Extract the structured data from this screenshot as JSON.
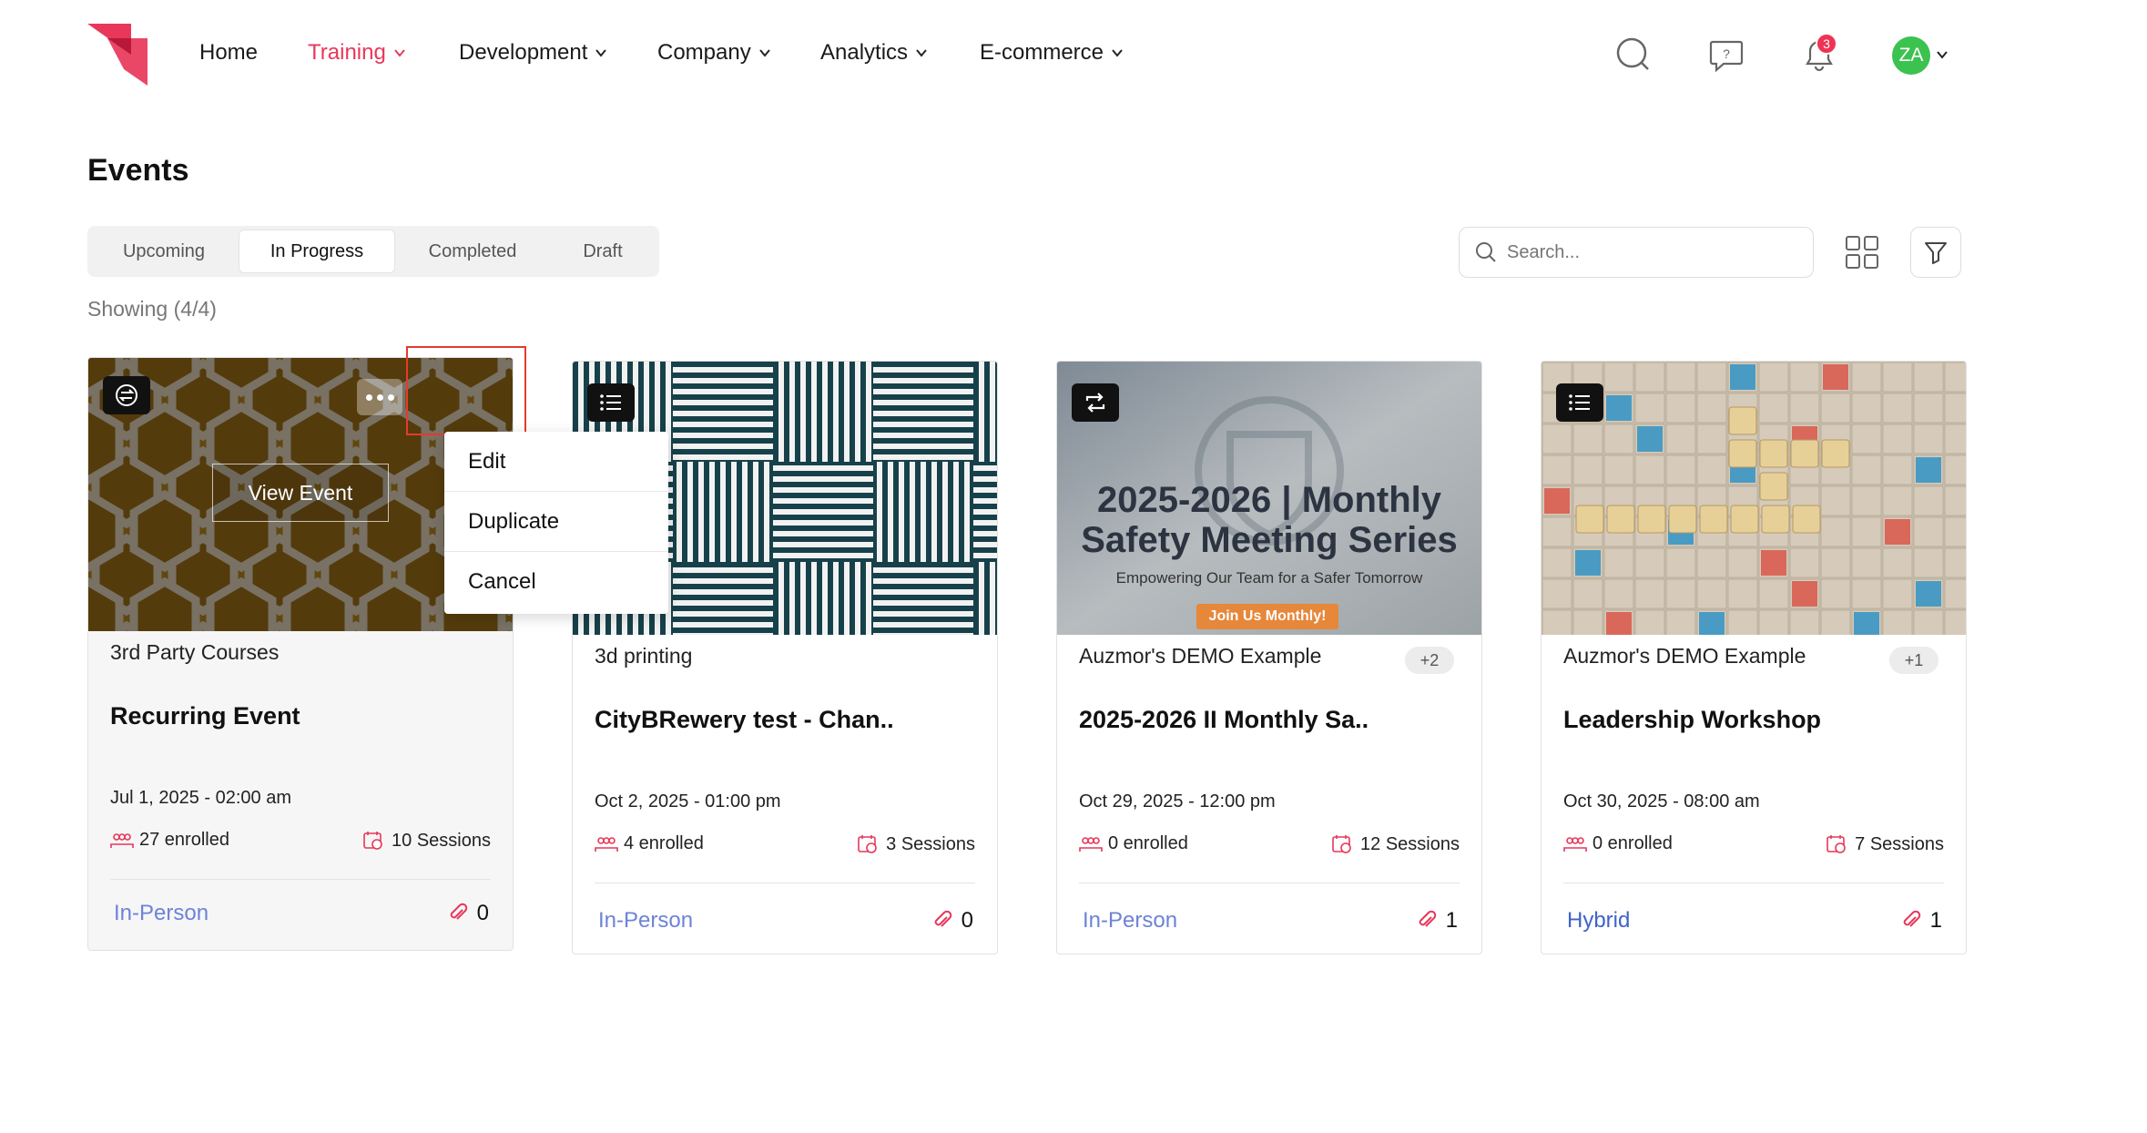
{
  "nav": {
    "items": [
      {
        "label": "Home",
        "has_dropdown": false,
        "active": false
      },
      {
        "label": "Training",
        "has_dropdown": true,
        "active": true
      },
      {
        "label": "Development",
        "has_dropdown": true,
        "active": false
      },
      {
        "label": "Company",
        "has_dropdown": true,
        "active": false
      },
      {
        "label": "Analytics",
        "has_dropdown": true,
        "active": false
      },
      {
        "label": "E-commerce",
        "has_dropdown": true,
        "active": false
      }
    ],
    "notification_count": "3",
    "avatar_initials": "ZA",
    "accent_color": "#e8375a"
  },
  "page": {
    "title": "Events",
    "tabs": [
      {
        "label": "Upcoming",
        "active": false
      },
      {
        "label": "In Progress",
        "active": true
      },
      {
        "label": "Completed",
        "active": false
      },
      {
        "label": "Draft",
        "active": false
      }
    ],
    "showing": "Showing (4/4)",
    "search_placeholder": "Search..."
  },
  "cards": [
    {
      "category": "3rd Party Courses",
      "extra_count": "",
      "title": "Recurring Event",
      "date": "Jul 1, 2025 - 02:00 am",
      "enrolled": "27 enrolled",
      "sessions": "10 Sessions",
      "mode": "In-Person",
      "attachments": "0",
      "type_icon": "recurring-icon",
      "view_label": "View Event"
    },
    {
      "category": "3d printing",
      "extra_count": "",
      "title": "CityBRewery test - Chan..",
      "date": "Oct 2, 2025 - 01:00 pm",
      "enrolled": "4 enrolled",
      "sessions": "3 Sessions",
      "mode": "In-Person",
      "attachments": "0",
      "type_icon": "list-icon"
    },
    {
      "category": "Auzmor's DEMO Example",
      "extra_count": "+2",
      "title": "2025-2026 II Monthly Sa..",
      "date": "Oct 29, 2025 - 12:00 pm",
      "enrolled": "0 enrolled",
      "sessions": "12 Sessions",
      "mode": "In-Person",
      "attachments": "1",
      "type_icon": "recurring-icon",
      "banner": {
        "headline_1": "2025-2026 | Monthly",
        "headline_2": "Safety Meeting Series",
        "subline": "Empowering Our Team for a Safer Tomorrow",
        "cta": "Join Us Monthly!"
      }
    },
    {
      "category": "Auzmor's DEMO Example",
      "extra_count": "+1",
      "title": "Leadership Workshop",
      "date": "Oct 30, 2025 - 08:00 am",
      "enrolled": "0 enrolled",
      "sessions": "7 Sessions",
      "mode": "Hybrid",
      "attachments": "1",
      "type_icon": "list-icon"
    }
  ],
  "context_menu": {
    "items": [
      "Edit",
      "Duplicate",
      "Cancel"
    ]
  }
}
